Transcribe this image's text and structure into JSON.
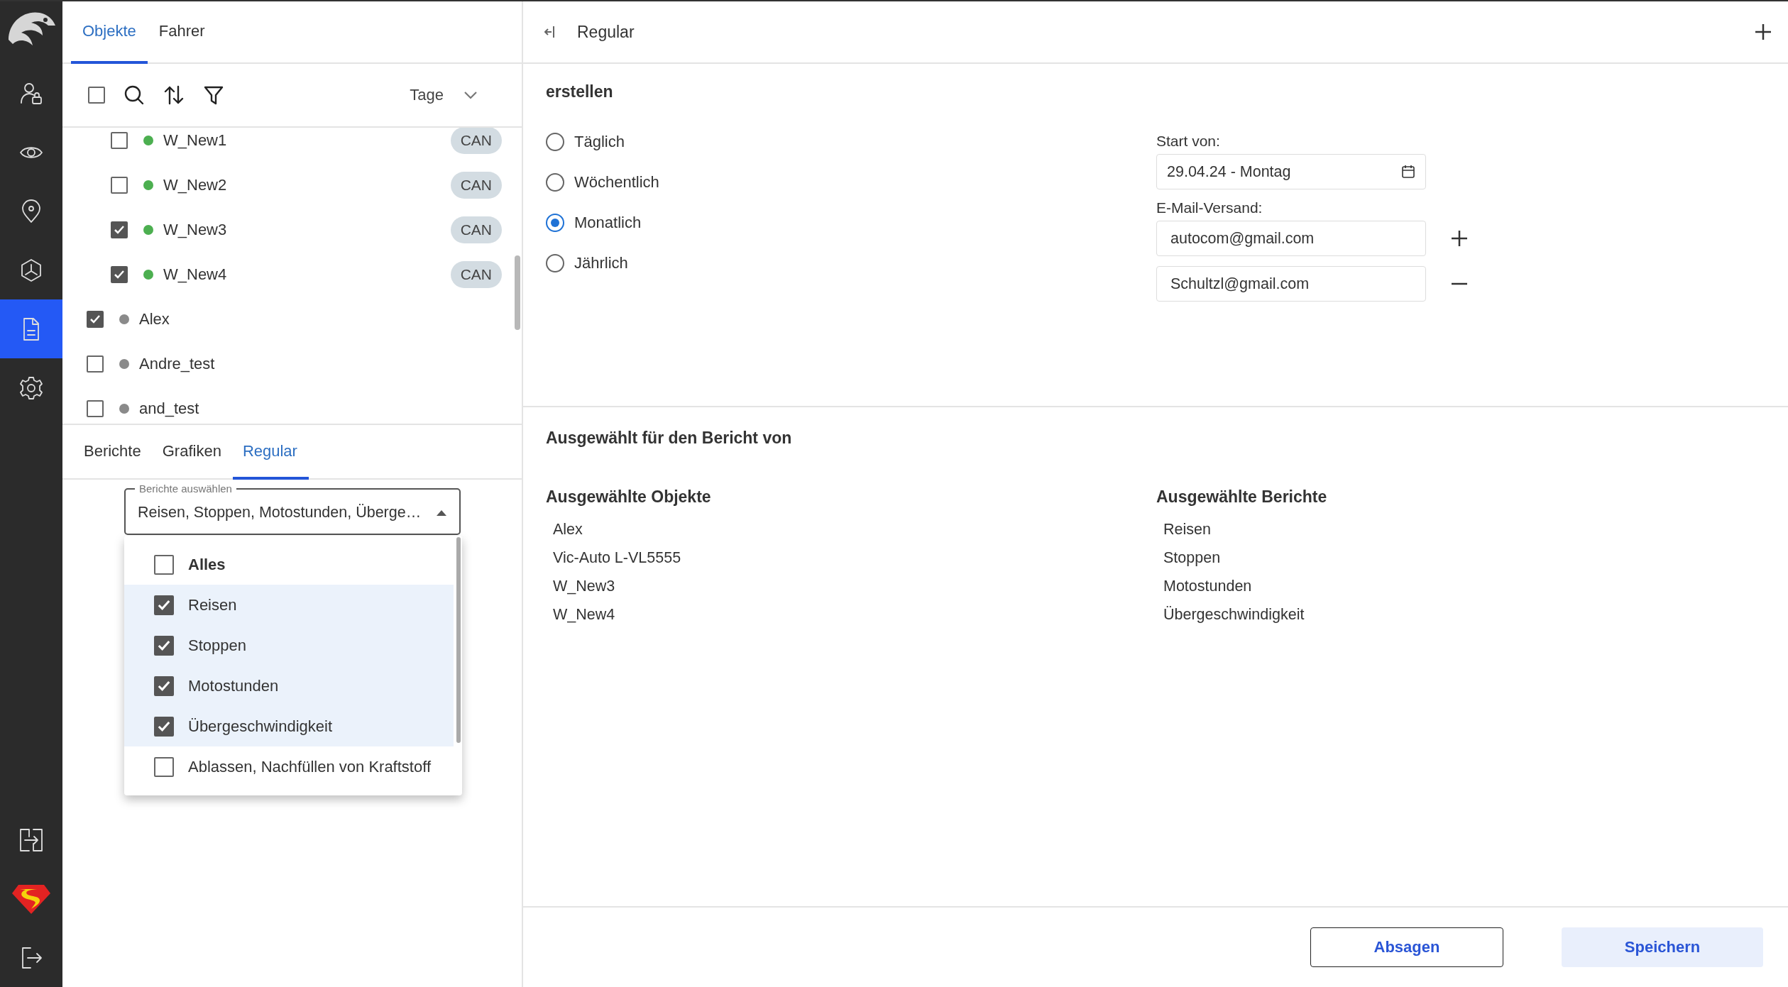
{
  "sidebar": {
    "nav_items": [
      {
        "kind": "user-lock",
        "selected": false
      },
      {
        "kind": "eye",
        "selected": false
      },
      {
        "kind": "pin",
        "selected": false
      },
      {
        "kind": "hexagon",
        "selected": false
      },
      {
        "kind": "document",
        "selected": true
      },
      {
        "kind": "gear",
        "selected": false
      }
    ],
    "bottom_items": [
      {
        "kind": "export"
      },
      {
        "kind": "shield"
      },
      {
        "kind": "logout"
      }
    ]
  },
  "object_tabs": [
    {
      "label": "Objekte",
      "selected": true
    },
    {
      "label": "Fahrer",
      "selected": false
    }
  ],
  "toolbar": {
    "select_all_checked": false,
    "period": "Tage"
  },
  "objects": [
    {
      "children": [
        {
          "name": "W_New1",
          "checked": false,
          "color": "#4caf50",
          "tag": "CAN"
        },
        {
          "name": "W_New2",
          "checked": false,
          "color": "#4caf50",
          "tag": "CAN"
        },
        {
          "name": "W_New3",
          "checked": true,
          "color": "#4caf50",
          "tag": "CAN"
        },
        {
          "name": "W_New4",
          "checked": true,
          "color": "#4caf50",
          "tag": "CAN"
        }
      ]
    },
    {
      "name": "Alex",
      "checked": true,
      "color": "#8a8a8a"
    },
    {
      "name": "Andre_test",
      "checked": false,
      "color": "#8a8a8a"
    },
    {
      "name": "and_test",
      "checked": false,
      "color": "#8a8a8a"
    }
  ],
  "report_tabs": [
    {
      "label": "Berichte",
      "selected": false
    },
    {
      "label": "Grafiken",
      "selected": false
    },
    {
      "label": "Regular",
      "selected": true
    }
  ],
  "report_select": {
    "label": "Berichte auswählen",
    "value": "Reisen, Stoppen, Motostunden, Überge…",
    "expanded": true,
    "options": [
      {
        "label": "Alles",
        "checked": false,
        "kind": "all"
      },
      {
        "label": "Reisen",
        "checked": true,
        "kind": "item"
      },
      {
        "label": "Stoppen",
        "checked": true,
        "kind": "item"
      },
      {
        "label": "Motostunden",
        "checked": true,
        "kind": "item"
      },
      {
        "label": "Übergeschwindigkeit",
        "checked": true,
        "kind": "item"
      },
      {
        "label": "Ablassen, Nachfüllen von Kraftstoff",
        "checked": false,
        "kind": "item"
      }
    ]
  },
  "header": {
    "title": "Regular"
  },
  "create": {
    "title": "erstellen",
    "frequency": [
      {
        "label": "Täglich",
        "selected": false
      },
      {
        "label": "Wöchentlich",
        "selected": false
      },
      {
        "label": "Monatlich",
        "selected": true
      },
      {
        "label": "Jährlich",
        "selected": false
      }
    ],
    "start": {
      "label": "Start von:",
      "value": "29.04.24 - Montag"
    },
    "email": {
      "label": "E-Mail-Versand:",
      "addresses": [
        {
          "value": "autocom@gmail.com",
          "kind": "add"
        },
        {
          "value": "Schultzl@gmail.com",
          "kind": "remove"
        }
      ]
    }
  },
  "summary": {
    "title": "Ausgewählt für den Bericht von",
    "columns": [
      {
        "heading": "Ausgewählte Objekte",
        "items": [
          "Alex",
          "Vic-Auto L-VL5555",
          "W_New3",
          "W_New4"
        ]
      },
      {
        "heading": "Ausgewählte Berichte",
        "items": [
          "Reisen",
          "Stoppen",
          "Motostunden",
          "Übergeschwindigkeit"
        ]
      }
    ]
  },
  "buttons": [
    {
      "label": "Absagen",
      "kind": "outline"
    },
    {
      "label": "Speichern",
      "kind": "primary"
    }
  ]
}
